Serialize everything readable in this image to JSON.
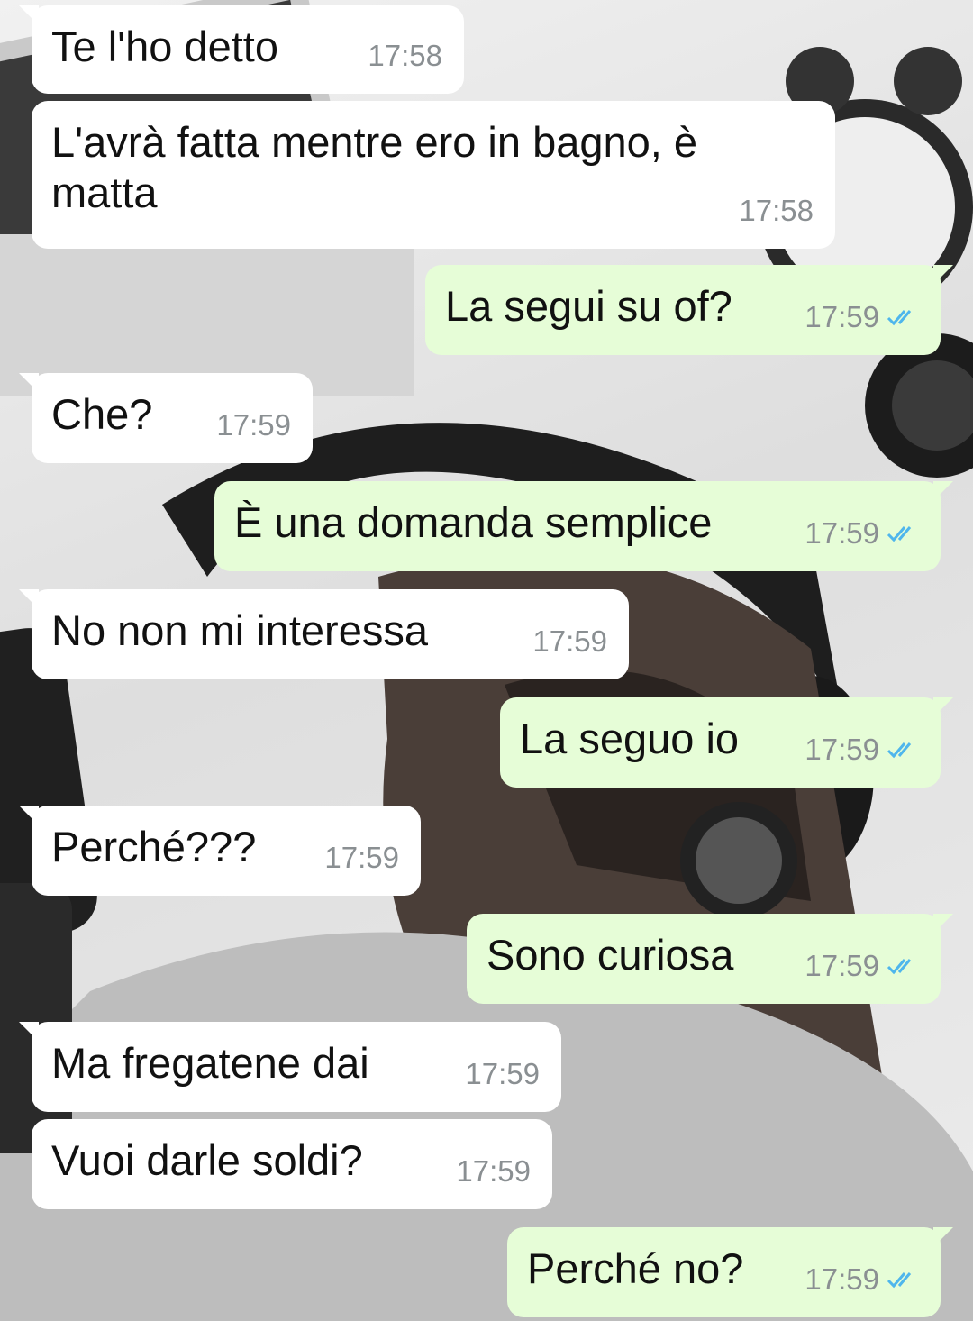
{
  "colors": {
    "incoming_bubble": "#ffffff",
    "outgoing_bubble": "#e6fdd7",
    "timestamp": "#8a8f92",
    "read_ticks": "#4fb6ec"
  },
  "messages": [
    {
      "direction": "incoming",
      "text": "Te l'ho detto",
      "time": "17:58"
    },
    {
      "direction": "incoming",
      "text": "L'avrà fatta mentre ero in bagno, è matta",
      "time": "17:58"
    },
    {
      "direction": "outgoing",
      "text": "La segui su of?",
      "time": "17:59",
      "status": "read"
    },
    {
      "direction": "incoming",
      "text": "Che?",
      "time": "17:59"
    },
    {
      "direction": "outgoing",
      "text": "È una domanda semplice",
      "time": "17:59",
      "status": "read"
    },
    {
      "direction": "incoming",
      "text": "No non mi interessa",
      "time": "17:59"
    },
    {
      "direction": "outgoing",
      "text": "La seguo io",
      "time": "17:59",
      "status": "read"
    },
    {
      "direction": "incoming",
      "text": "Perché???",
      "time": "17:59"
    },
    {
      "direction": "outgoing",
      "text": "Sono curiosa",
      "time": "17:59",
      "status": "read"
    },
    {
      "direction": "incoming",
      "text": "Ma fregatene dai",
      "time": "17:59"
    },
    {
      "direction": "incoming",
      "text": "Vuoi darle soldi?",
      "time": "17:59"
    },
    {
      "direction": "outgoing",
      "text": "Perché no?",
      "time": "17:59",
      "status": "read"
    }
  ]
}
